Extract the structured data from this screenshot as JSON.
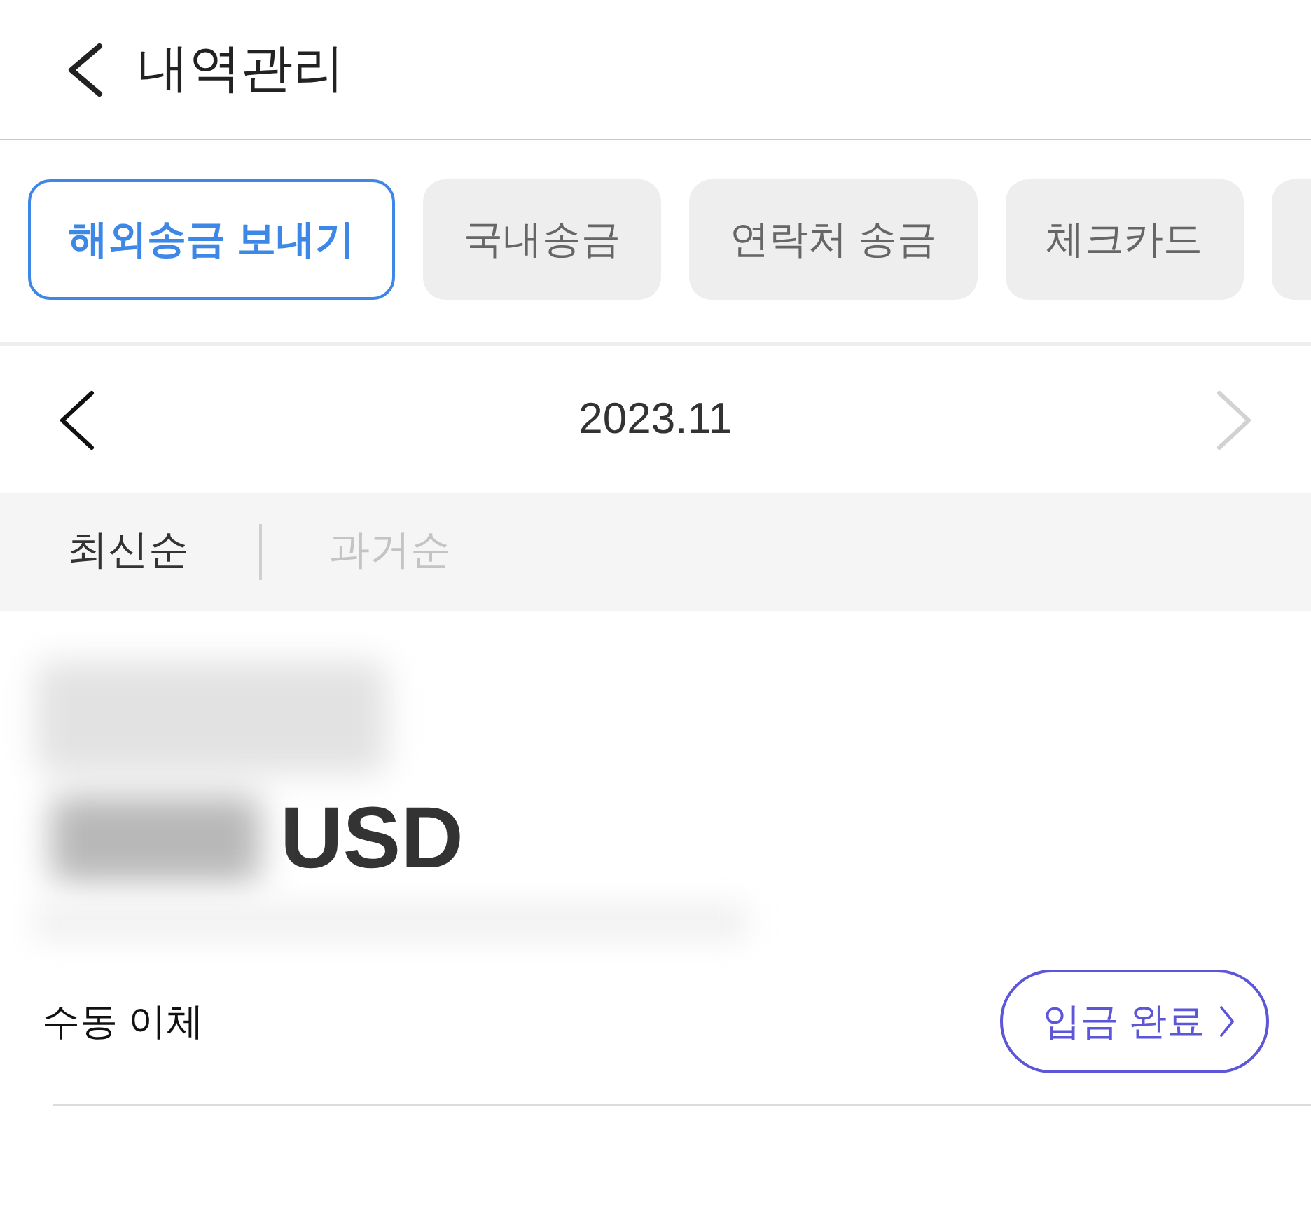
{
  "header": {
    "title": "내역관리"
  },
  "tabs": [
    {
      "label": "해외송금 보내기",
      "selected": true
    },
    {
      "label": "국내송금",
      "selected": false
    },
    {
      "label": "연락처 송금",
      "selected": false
    },
    {
      "label": "체크카드",
      "selected": false
    },
    {
      "selected": false
    }
  ],
  "month_nav": {
    "label": "2023.11",
    "prev_disabled": false,
    "next_disabled": true
  },
  "sort_options": [
    {
      "label": "최신순",
      "selected": true
    },
    {
      "label": "과거순",
      "selected": false
    }
  ],
  "transaction": {
    "currency": "USD",
    "method": "수동 이체",
    "status_button": "입금 완료"
  }
}
